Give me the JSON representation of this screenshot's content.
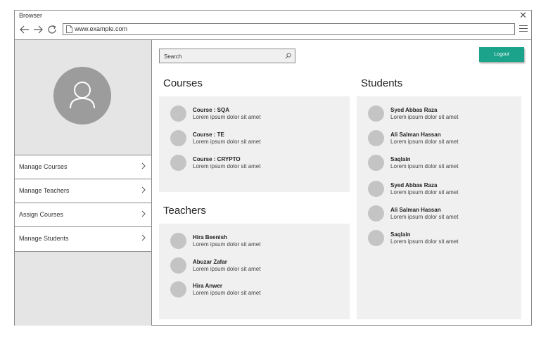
{
  "browser": {
    "title": "Browser",
    "url": "www.example.com"
  },
  "sidebar": {
    "items": [
      {
        "label": "Manage Courses"
      },
      {
        "label": "Manage Teachers"
      },
      {
        "label": "Assign Courses"
      },
      {
        "label": "Manage Students"
      }
    ]
  },
  "search": {
    "placeholder": "Search"
  },
  "logout_label": "Logout",
  "courses": {
    "title": "Courses",
    "items": [
      {
        "name": "Course : SQA",
        "sub": "Lorem ipsum dolor sit amet"
      },
      {
        "name": "Course : TE",
        "sub": "Lorem ipsum dolor sit amet"
      },
      {
        "name": "Course : CRYPTO",
        "sub": "Lorem ipsum dolor sit amet"
      }
    ]
  },
  "teachers": {
    "title": "Teachers",
    "items": [
      {
        "name": "Hira Beenish",
        "sub": "Lorem ipsum dolor sit amet"
      },
      {
        "name": "Abuzar Zafar",
        "sub": "Lorem ipsum dolor sit amet"
      },
      {
        "name": "Hira Anwer",
        "sub": "Lorem ipsum dolor sit amet"
      }
    ]
  },
  "students": {
    "title": "Students",
    "items": [
      {
        "name": "Syed Abbas Raza",
        "sub": "Lorem ipsum dolor sit amet"
      },
      {
        "name": "Ali Salman Hassan",
        "sub": "Lorem ipsum dolor sit amet"
      },
      {
        "name": "Saqlain",
        "sub": "Lorem ipsum dolor sit amet"
      },
      {
        "name": "Syed Abbas Raza",
        "sub": "Lorem ipsum dolor sit amet"
      },
      {
        "name": "Ali Salman Hassan",
        "sub": "Lorem ipsum dolor sit amet"
      },
      {
        "name": "Saqlain",
        "sub": "Lorem ipsum dolor sit amet"
      }
    ]
  },
  "colors": {
    "accent": "#1ba38b",
    "sidebar_bg": "#e5e5e5",
    "panel_bg": "#f0f0f0",
    "avatar": "#9c9c9c"
  }
}
